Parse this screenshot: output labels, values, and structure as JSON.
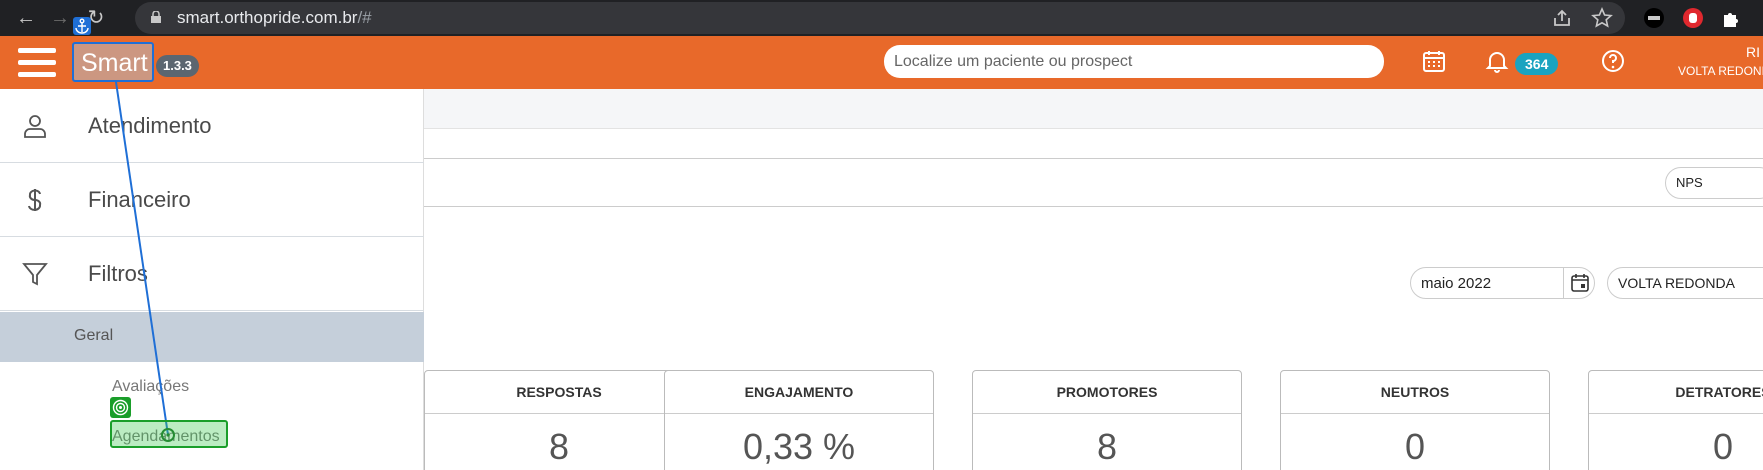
{
  "browser": {
    "url_host": "smart.orthopride.com.br",
    "url_path": "/#"
  },
  "app": {
    "brand": "Smart",
    "version": "1.3.3",
    "search_placeholder": "Localize um paciente ou prospect",
    "notification_count": "364",
    "user_initials": "RI",
    "user_unit": "VOLTA REDONDA"
  },
  "sidebar": {
    "items": [
      {
        "label": "Atendimento",
        "icon": "user-icon"
      },
      {
        "label": "Financeiro",
        "icon": "dollar-icon"
      },
      {
        "label": "Filtros",
        "icon": "filter-icon"
      }
    ],
    "section": "Geral",
    "subitems": [
      "Avaliações",
      "Agendamentos"
    ]
  },
  "filters": {
    "report_type": "NPS",
    "period": "maio 2022",
    "unit": "VOLTA REDONDA"
  },
  "kpis": [
    {
      "label": "RESPOSTAS",
      "value": "8"
    },
    {
      "label": "ENGAJAMENTO",
      "value": "0,33 %"
    },
    {
      "label": "PROMOTORES",
      "value": "8"
    },
    {
      "label": "NEUTROS",
      "value": "0"
    },
    {
      "label": "DETRATORES",
      "value": "0"
    }
  ],
  "colors": {
    "appbar": "#e8692a",
    "badge": "#1aa3c0",
    "sidebar_section": "#c5cfda",
    "anchor": "#1f6fd6",
    "target": "#1a9e2a"
  }
}
